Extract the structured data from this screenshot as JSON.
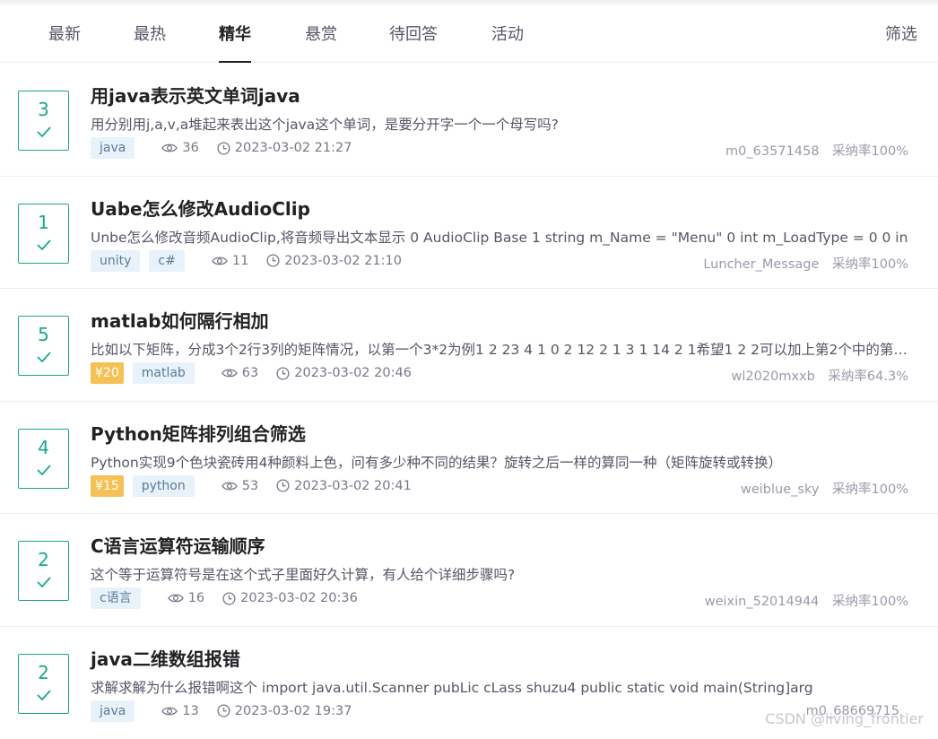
{
  "tabs": [
    "最新",
    "最热",
    "精华",
    "悬赏",
    "待回答",
    "活动"
  ],
  "filter_label": "筛选",
  "accept_label": "采纳率",
  "questions": [
    {
      "answers": "3",
      "title": "用java表示英文单词java",
      "desc": "用分别用j,a,v,a堆起来表出这个java这个单词，是要分开字一个一个母写吗?",
      "bounty": "",
      "tags": [
        "java"
      ],
      "views": "36",
      "time": "2023-03-02 21:27",
      "user": "m0_63571458",
      "rate": "100%"
    },
    {
      "answers": "1",
      "title": "Uabe怎么修改AudioClip",
      "desc": "Unbe怎么修改音频AudioClip,将音频导出文本显示 0 AudioClip Base 1 string m_Name = \"Menu\" 0 int m_LoadType = 0 0 in",
      "bounty": "",
      "tags": [
        "unity",
        "c#"
      ],
      "views": "11",
      "time": "2023-03-02 21:10",
      "user": "Luncher_Message",
      "rate": "100%"
    },
    {
      "answers": "5",
      "title": "matlab如何隔行相加",
      "desc": "比如以下矩阵，分成3个2行3列的矩阵情况，以第一个3*2为例1 2 23 4 1 0 2 12 2 1 3 1 14 2 1希望1 2 2可以加上第2个中的第2行",
      "bounty": "¥20",
      "tags": [
        "matlab"
      ],
      "views": "63",
      "time": "2023-03-02 20:46",
      "user": "wl2020mxxb",
      "rate": "64.3%"
    },
    {
      "answers": "4",
      "title": "Python矩阵排列组合筛选",
      "desc": "Python实现9个色块瓷砖用4种颜料上色，问有多少种不同的结果？旋转之后一样的算同一种（矩阵旋转或转换）",
      "bounty": "¥15",
      "tags": [
        "python"
      ],
      "views": "53",
      "time": "2023-03-02 20:41",
      "user": "weiblue_sky",
      "rate": "100%"
    },
    {
      "answers": "2",
      "title": "C语言运算符运输顺序",
      "desc": "这个等于运算符号是在这个式子里面好久计算，有人给个详细步骤吗?",
      "bounty": "",
      "tags": [
        "c语言"
      ],
      "views": "16",
      "time": "2023-03-02 20:36",
      "user": "weixin_52014944",
      "rate": "100%"
    },
    {
      "answers": "2",
      "title": "java二维数组报错",
      "desc": "求解求解为什么报错啊这个 import java.util.Scanner pubLic cLass shuzu4 public static void main(String]arg",
      "bounty": "",
      "tags": [
        "java"
      ],
      "views": "13",
      "time": "2023-03-02 19:37",
      "user": "m0_68669715",
      "rate": ""
    }
  ],
  "watermark": "CSDN @living_frontier",
  "colors": {
    "accent": "#1aa88b",
    "bounty": "#f5c155",
    "tag_bg": "#e8f2fa"
  },
  "icons": {
    "views": "eye-icon",
    "time": "clock-icon",
    "answered": "check-icon"
  }
}
